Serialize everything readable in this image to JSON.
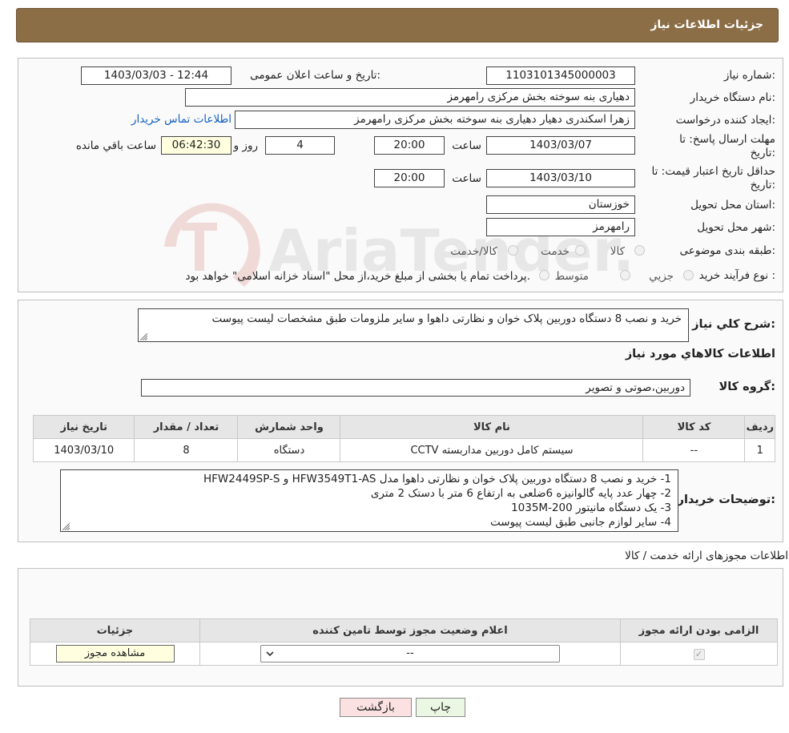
{
  "header": {
    "title": "جزئیات اطلاعات نیاز"
  },
  "form": {
    "need_number_label": "شماره نیاز:",
    "need_number": "1103101345000003",
    "announce_label": "تاریخ و ساعت اعلان عمومی:",
    "announce_value": "1403/03/03 - 12:44",
    "buyer_label": "نام دستگاه خریدار:",
    "buyer_value": "دهیاری بنه سوخته بخش مرکزی رامهرمز",
    "creator_label": "ایجاد کننده درخواست:",
    "creator_value": "زهرا اسکندری دهیار دهیاری بنه سوخته بخش مرکزی رامهرمز",
    "contact_link": "اطلاعات تماس خریدار",
    "deadline_label_1": "مهلت ارسال پاسخ: تا",
    "deadline_label_2": "تاریخ:",
    "deadline_date": "1403/03/07",
    "time_label": "ساعت",
    "deadline_time": "20:00",
    "days_value": "4",
    "days_label": "روز و",
    "remaining_time": "06:42:30",
    "remaining_label": "ساعت باقي مانده",
    "validity_label_1": "حداقل تاریخ اعتبار قیمت: تا",
    "validity_label_2": "تاریخ:",
    "validity_date": "1403/03/10",
    "validity_time_label": "ساعت",
    "validity_time": "20:00",
    "province_label": "استان محل تحویل:",
    "province_value": "خوزستان",
    "city_label": "شهر محل تحویل:",
    "city_value": "رامهرمز",
    "category_label": "طبقه بندی موضوعی:",
    "category_options": [
      "کالا",
      "خدمت",
      "کالا/خدمت"
    ],
    "process_label": "نوع فرآیند خرید :",
    "process_options": [
      "جزيي",
      "متوسط"
    ],
    "process_note": "پرداخت تمام یا بخشی از مبلغ خرید،از محل \"اسناد خزانه اسلامی\" خواهد بود."
  },
  "description": {
    "label": "شرح کلي نیاز:",
    "value": "خرید و نصب 8 دستگاه دوربین پلاک خوان و نظارتی داهوا و سایر ملزومات طبق مشخصات لیست پیوست",
    "goods_heading": "اطلاعات کالاهاي مورد نياز",
    "group_label": "گروه کالا:",
    "group_value": "دوربین،صوتی و تصویر"
  },
  "goods_table": {
    "headers": [
      "رديف",
      "کد کالا",
      "نام کالا",
      "واحد شمارش",
      "تعداد / مقدار",
      "تاریخ نیاز"
    ],
    "rows": [
      [
        "1",
        "--",
        "سیستم کامل دوربین مداربسته CCTV",
        "دستگاه",
        "8",
        "1403/03/10"
      ]
    ]
  },
  "buyer_notes": {
    "label": "توضیحات خریدار:",
    "lines": [
      "1-     خرید و نصب 8 دستگاه دوربین پلاک خوان و نظارتی داهوا مدل  HFW3549T1-AS  و HFW2449SP-S",
      "2-     چهار عدد پایه گالوانیزه 6ضلعی به ارتفاع 6 متر با دستک 2 متری",
      "3-     یک دستگاه مانیتور 1035M-200",
      "4-     سایر لوازم جانبی طبق لیست پیوست"
    ]
  },
  "permits": {
    "title": "اطلاعات مجوزهای ارائه خدمت / کالا",
    "headers": [
      "الزامی بودن ارائه مجوز",
      "اعلام وضعیت مجوز توسط تامین کننده",
      "جزئیات"
    ],
    "select_value": "--",
    "view_button": "مشاهده مجوز"
  },
  "actions": {
    "print": "چاپ",
    "back": "بازگشت"
  },
  "watermark": {
    "text": "AriaTender.neT"
  }
}
